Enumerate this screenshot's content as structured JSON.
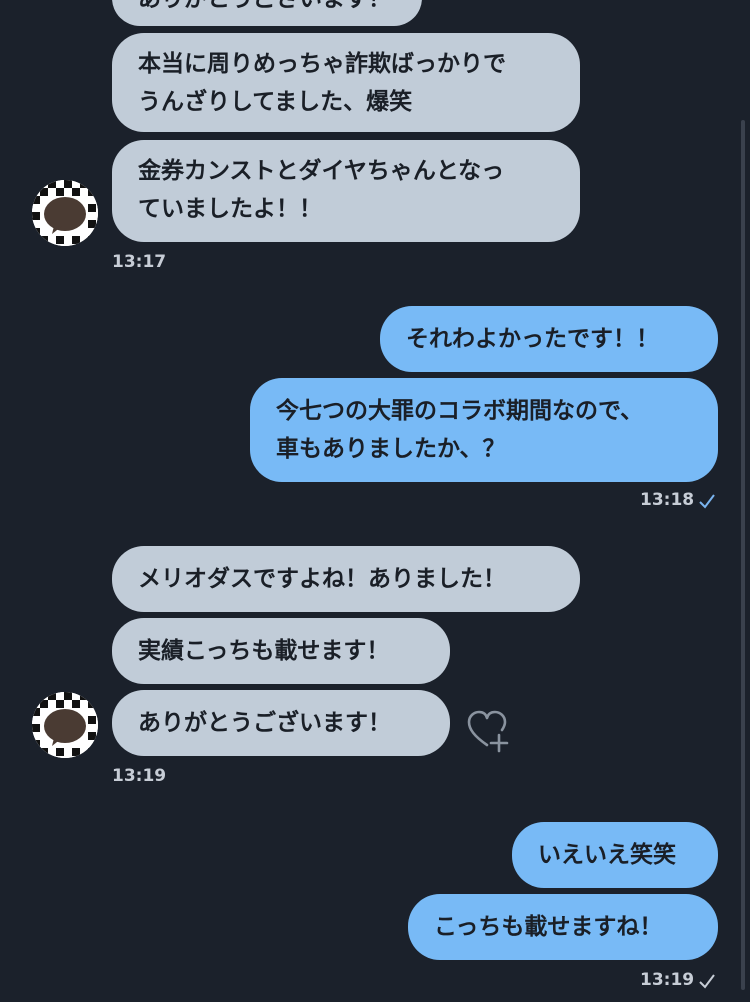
{
  "colors": {
    "background": "#1b212b",
    "received_bubble": "#c1ccd8",
    "sent_bubble": "#78baf6",
    "read_check": "#7ab4ef",
    "timestamp": "#c7cdd6"
  },
  "group1": {
    "messages": [
      "ありがとうございます！",
      "本当に周りめっちゃ詐欺ばっかりで",
      "うんざりしてました、爆笑",
      "金券カンストとダイヤちゃんとなっ",
      "ていましたよ！！"
    ],
    "time": "13:17"
  },
  "group2": {
    "messages": [
      "それわよかったです！！",
      "今七つの大罪のコラボ期間なので、",
      "車もありましたか、？"
    ],
    "time": "13:18",
    "status_icon": "check-icon"
  },
  "group3": {
    "messages": [
      "メリオダスですよね！ありました！",
      "実績こっちも載せます！",
      "ありがとうございます！"
    ],
    "time": "13:19",
    "reaction_icon": "heart-plus-icon"
  },
  "group4": {
    "messages": [
      "いえいえ笑笑",
      "こっちも載せますね！"
    ],
    "time": "13:19",
    "status_icon": "check-icon"
  }
}
